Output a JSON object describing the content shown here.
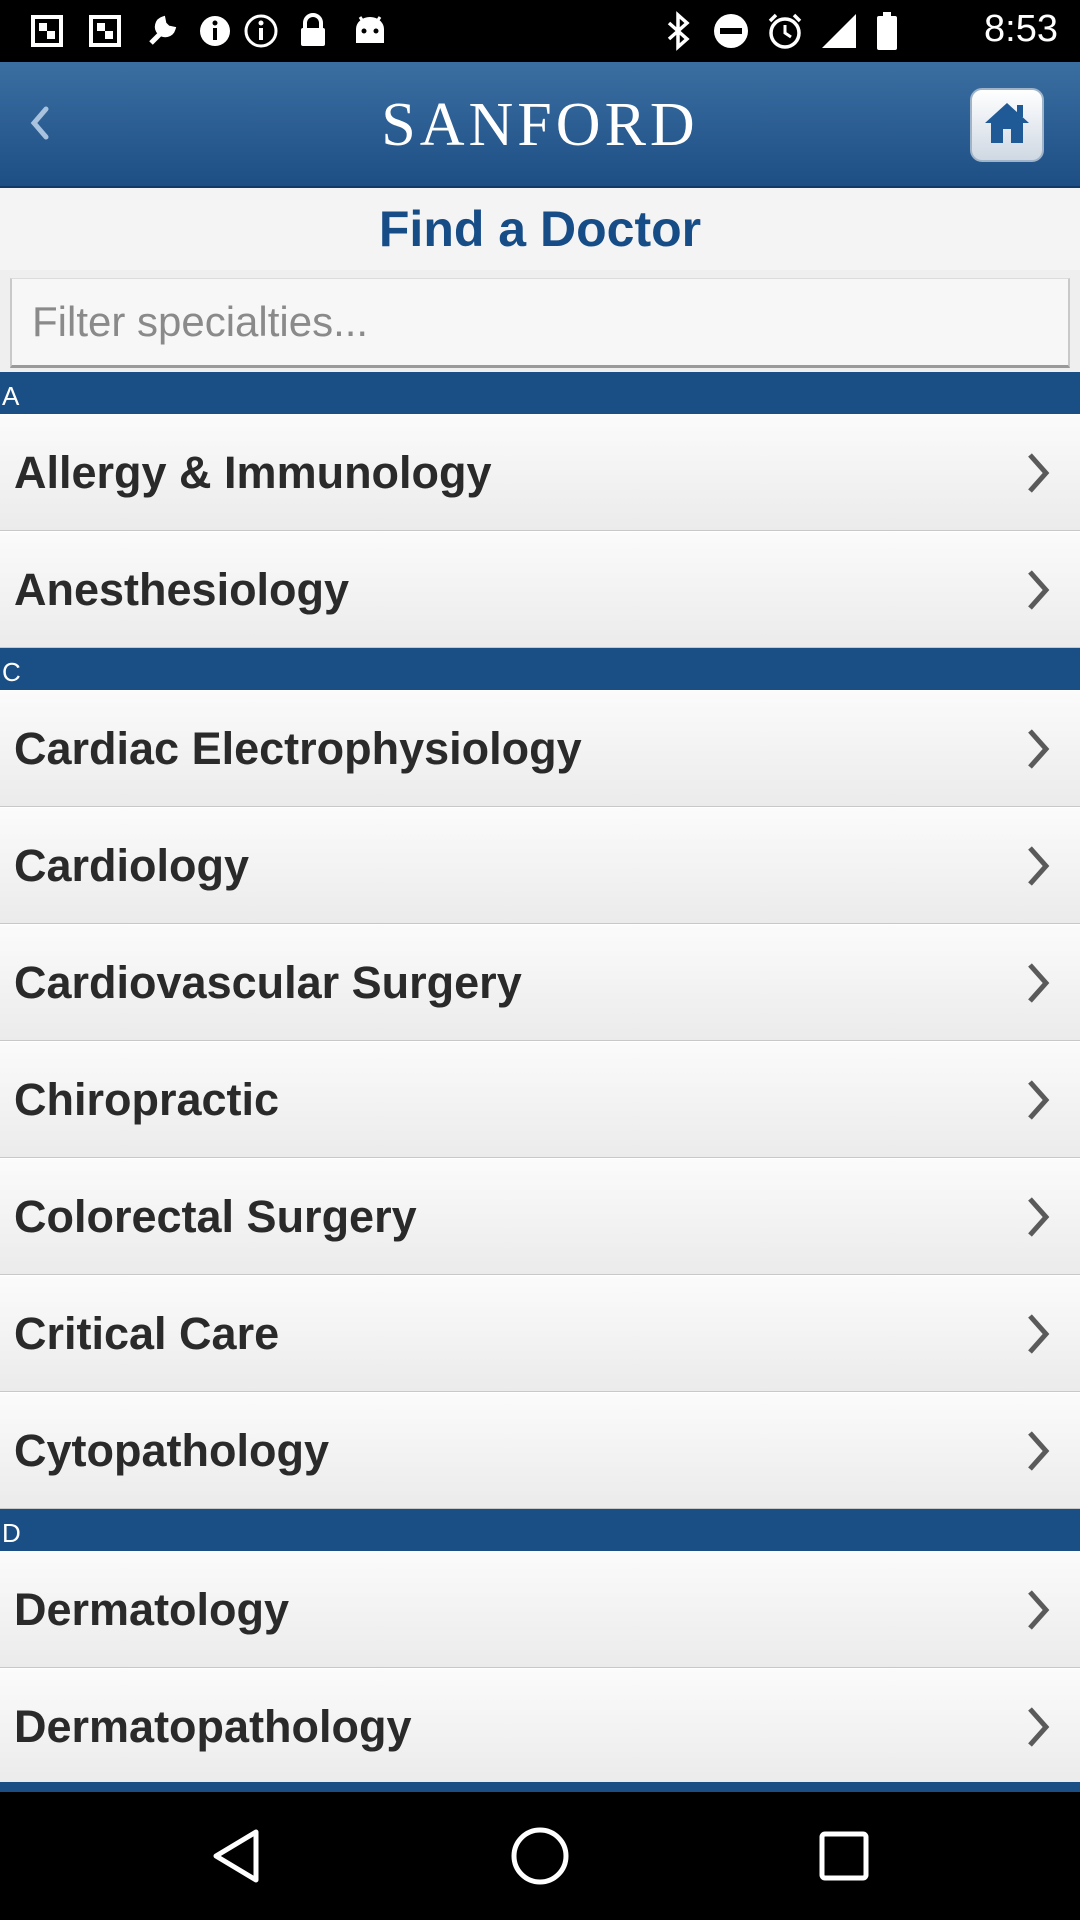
{
  "status_bar": {
    "time": "8:53",
    "left_icons": [
      "notification-icon",
      "notification-icon",
      "wrench-icon",
      "info-icon",
      "lock-icon",
      "android-icon"
    ],
    "right_icons": [
      "bluetooth-icon",
      "do-not-disturb-icon",
      "alarm-icon",
      "signal-icon",
      "battery-icon"
    ]
  },
  "header": {
    "logo_text": "SANFORD",
    "accent": "#1d4f85"
  },
  "page": {
    "title": "Find a Doctor"
  },
  "filter": {
    "placeholder": "Filter specialties...",
    "value": ""
  },
  "sections": [
    {
      "letter": "A",
      "items": [
        "Allergy & Immunology",
        "Anesthesiology"
      ]
    },
    {
      "letter": "C",
      "items": [
        "Cardiac Electrophysiology",
        "Cardiology",
        "Cardiovascular Surgery",
        "Chiropractic",
        "Colorectal Surgery",
        "Critical Care",
        "Cytopathology"
      ]
    },
    {
      "letter": "D",
      "items": [
        "Dermatology",
        "Dermatopathology"
      ]
    }
  ],
  "nav": {
    "buttons": [
      "back-nav-icon",
      "home-nav-icon",
      "recents-nav-icon"
    ]
  }
}
